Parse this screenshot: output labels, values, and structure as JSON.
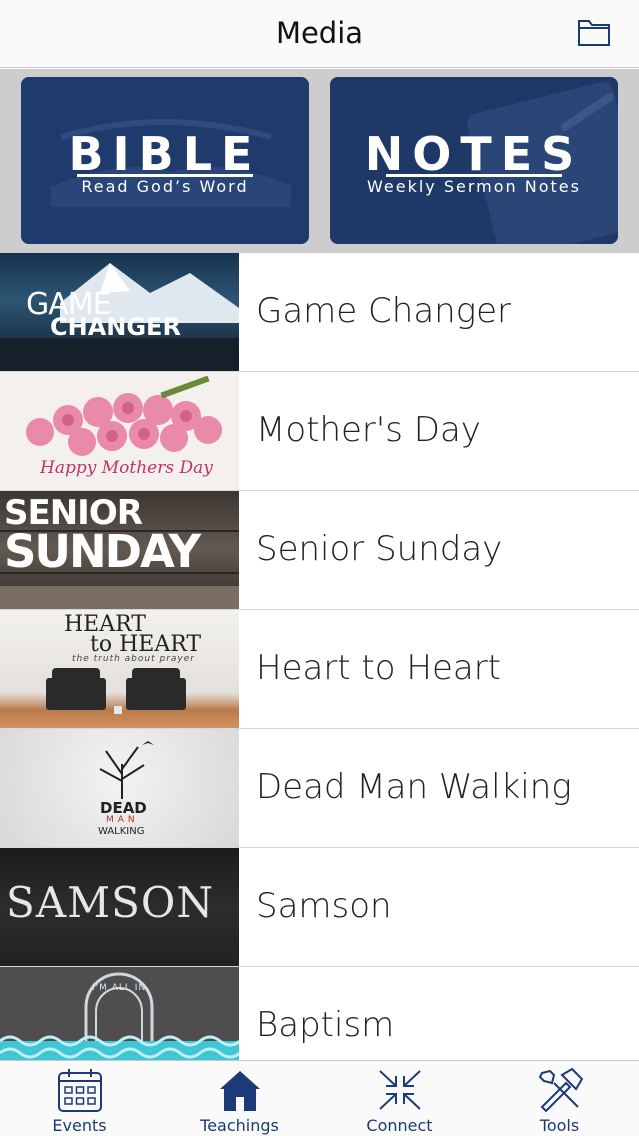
{
  "header": {
    "title": "Media",
    "folder_icon": "folder-icon"
  },
  "cards": [
    {
      "title": "BIBLE",
      "subtitle": "Read God’s Word"
    },
    {
      "title": "NOTES",
      "subtitle": "Weekly Sermon Notes"
    }
  ],
  "teachings": [
    {
      "label": "Game Changer",
      "thumb_line1": "GAME",
      "thumb_line2": "CHANGER"
    },
    {
      "label": "Mother's Day",
      "thumb_line1": "Happy Mothers Day"
    },
    {
      "label": "Senior Sunday",
      "thumb_line1": "SENIOR",
      "thumb_line2": "SUNDAY"
    },
    {
      "label": "Heart to Heart",
      "thumb_line1": "HEART",
      "thumb_line2": "to HEART",
      "thumb_line3": "the truth about prayer"
    },
    {
      "label": "Dead Man Walking",
      "thumb_line1": "DEAD",
      "thumb_line2": "MAN",
      "thumb_line3": "WALKING"
    },
    {
      "label": "Samson",
      "thumb_line1": "SAMSON"
    },
    {
      "label": "Baptism",
      "thumb_line1": "I'M ALL IN"
    }
  ],
  "tabs": [
    {
      "label": "Events",
      "icon": "calendar-icon",
      "selected": false
    },
    {
      "label": "Teachings",
      "icon": "home-icon",
      "selected": true
    },
    {
      "label": "Connect",
      "icon": "connect-arrows-icon",
      "selected": false
    },
    {
      "label": "Tools",
      "icon": "tools-icon",
      "selected": false
    }
  ],
  "colors": {
    "accent": "#1c3a78",
    "card_bg": "#1e3868",
    "card_tray": "#cdcdcd"
  }
}
